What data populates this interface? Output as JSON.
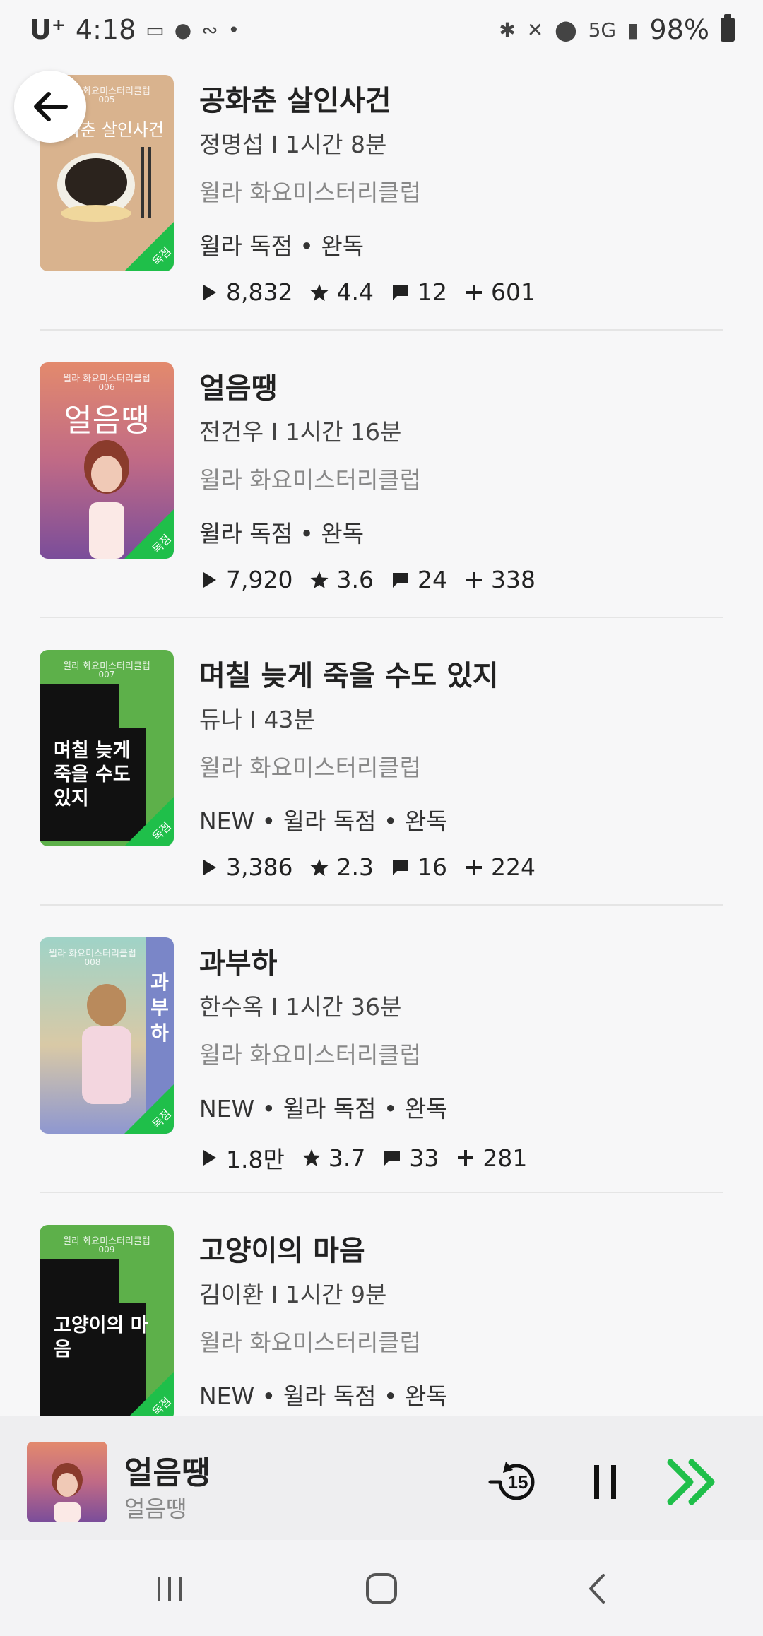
{
  "status_bar": {
    "carrier": "U⁺",
    "time": "4:18",
    "battery": "98%",
    "network": "5G"
  },
  "list": [
    {
      "title": "공화춘 살인사건",
      "author_duration": "정명섭 I 1시간 8분",
      "series": "윌라 화요미스터리클럽",
      "tags": "윌라 독점 • 완독",
      "plays": "8,832",
      "rating": "4.4",
      "comments": "12",
      "adds": "601",
      "cover_title": "공화춘 살인사건",
      "cover_series": "윌라 화요미스터리클럽",
      "cover_num": "005",
      "cover_color": "#d9b38e"
    },
    {
      "title": "얼음땡",
      "author_duration": "전건우 I 1시간 16분",
      "series": "윌라 화요미스터리클럽",
      "tags": "윌라 독점 • 완독",
      "plays": "7,920",
      "rating": "3.6",
      "comments": "24",
      "adds": "338",
      "cover_title": "얼음땡",
      "cover_series": "윌라 화요미스터리클럽",
      "cover_num": "006",
      "cover_color": "#c76e79"
    },
    {
      "title": "며칠 늦게 죽을 수도 있지",
      "author_duration": "듀나 I 43분",
      "series": "윌라 화요미스터리클럽",
      "tags": "NEW • 윌라 독점 • 완독",
      "plays": "3,386",
      "rating": "2.3",
      "comments": "16",
      "adds": "224",
      "cover_title": "며칠 늦게 죽을 수도 있지",
      "cover_series": "윌라 화요미스터리클럽",
      "cover_num": "007",
      "cover_color": "#5db04a"
    },
    {
      "title": "과부하",
      "author_duration": "한수옥 I 1시간 36분",
      "series": "윌라 화요미스터리클럽",
      "tags": "NEW • 윌라 독점 • 완독",
      "plays": "1.8만",
      "rating": "3.7",
      "comments": "33",
      "adds": "281",
      "cover_title": "과부하",
      "cover_series": "윌라 화요미스터리클럽",
      "cover_num": "008",
      "cover_color": "#7a86c8"
    },
    {
      "title": "고양이의 마음",
      "author_duration": "김이환 I 1시간 9분",
      "series": "윌라 화요미스터리클럽",
      "tags": "NEW • 윌라 독점 • 완독",
      "plays": "",
      "rating": "",
      "comments": "",
      "adds": "",
      "cover_title": "고양이의 마음",
      "cover_series": "윌라 화요미스터리클럽",
      "cover_num": "009",
      "cover_color": "#5db04a"
    }
  ],
  "badge_label": "독점",
  "player": {
    "title": "얼음땡",
    "subtitle": "얼음땡",
    "rewind_label": "15",
    "accent": "#1fbf4a"
  }
}
